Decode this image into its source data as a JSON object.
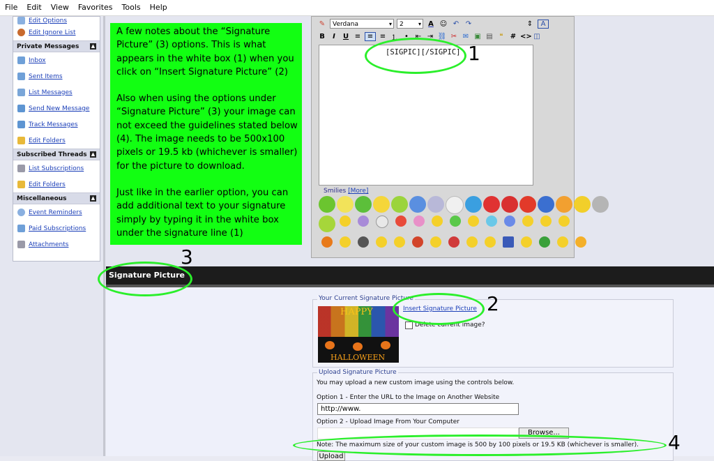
{
  "menubar": [
    "File",
    "Edit",
    "View",
    "Favorites",
    "Tools",
    "Help"
  ],
  "sidebar": {
    "top_items": [
      "Edit Options",
      "Edit Ignore List"
    ],
    "sections": [
      {
        "title": "Private Messages",
        "items": [
          "Inbox",
          "Sent Items",
          "List Messages",
          "Send New Message",
          "Track Messages",
          "Edit Folders"
        ]
      },
      {
        "title": "Subscribed Threads",
        "items": [
          "List Subscriptions",
          "Edit Folders"
        ]
      },
      {
        "title": "Miscellaneous",
        "items": [
          "Event Reminders",
          "Paid Subscriptions",
          "Attachments"
        ]
      }
    ]
  },
  "notes": [
    "A few notes about the “Signature Picture” (3) options. This is what appears in the white box (1) when you click on “Insert Signature Picture” (2)",
    "Also when using the options under “Signature Picture” (3) your image can not exceed the guidelines stated below (4). The image needs to be 500x100 pixels or 19.5 kb (whichever is smaller) for the picture to download.",
    "Just like in the earlier option, you can add additional text to your signature simply by typing it in the white box under the signature line (1)"
  ],
  "editor": {
    "font": "Verdana",
    "size": "2",
    "content": "[SIGPIC][/SIGPIC]",
    "smilies_label": "Smilies",
    "smilies_more": "[More]"
  },
  "callouts": {
    "one": "1",
    "two": "2",
    "three": "3",
    "four": "4"
  },
  "sigpic": {
    "section_title": "Signature Picture",
    "current_legend": "Your Current Signature Picture",
    "insert_link": "Insert Signature Picture",
    "delete_label": "Delete current image?",
    "image_text_top": "HAPPY",
    "image_text_bottom": "HALLOWEEN",
    "upload_legend": "Upload Signature Picture",
    "upload_intro": "You may upload a new custom image using the controls below.",
    "option1_label": "Option 1 - Enter the URL to the Image on Another Website",
    "url_value": "http://www.",
    "option2_label": "Option 2 - Upload Image From Your Computer",
    "browse_label": "Browse...",
    "note": "Note: The maximum size of your custom image is 500 by 100 pixels or 19.5 KB (whichever is smaller).",
    "upload_button": "Upload"
  }
}
